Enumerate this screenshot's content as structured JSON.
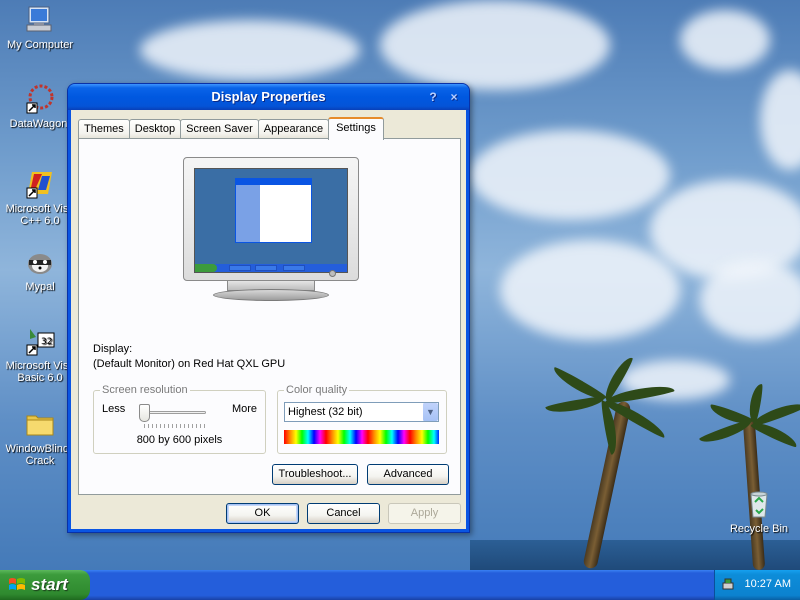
{
  "desktop": {
    "icons": [
      {
        "label": "My Computer",
        "icon": "my-computer-icon"
      },
      {
        "label": "DataWagon.",
        "icon": "shortcut-icon"
      },
      {
        "label_line1": "Microsoft Visu",
        "label_line2": "C++ 6.0",
        "icon": "visual-cpp-icon"
      },
      {
        "label": "Mypal",
        "icon": "mypal-icon"
      },
      {
        "label_line1": "Microsoft Visu",
        "label_line2": "Basic 6.0",
        "icon": "visual-basic-icon"
      },
      {
        "label_line1": "WindowBlinds",
        "label_line2": "Crack",
        "icon": "folder-icon"
      },
      {
        "label": "Recycle Bin",
        "icon": "recycle-bin-icon"
      }
    ]
  },
  "dialog": {
    "title": "Display Properties",
    "help_glyph": "?",
    "close_glyph": "×",
    "tabs": [
      {
        "label": "Themes",
        "active": false
      },
      {
        "label": "Desktop",
        "active": false
      },
      {
        "label": "Screen Saver",
        "active": false
      },
      {
        "label": "Appearance",
        "active": false
      },
      {
        "label": "Settings",
        "active": true
      }
    ],
    "display_label": "Display:",
    "display_value": "(Default Monitor) on Red Hat QXL GPU",
    "resolution": {
      "group_title": "Screen resolution",
      "less": "Less",
      "more": "More",
      "value_text": "800 by 600 pixels",
      "slider_level": 0
    },
    "color_quality": {
      "group_title": "Color quality",
      "selected": "Highest (32 bit)"
    },
    "buttons": {
      "troubleshoot": "Troubleshoot...",
      "advanced": "Advanced",
      "ok": "OK",
      "cancel": "Cancel",
      "apply": "Apply"
    }
  },
  "taskbar": {
    "start_label": "start",
    "clock": "10:27 AM"
  },
  "colors": {
    "titlebar": "#0058e0",
    "taskbar": "#245edb",
    "start": "#3c9b3c",
    "tray": "#0c82cf",
    "dialog_bg": "#ece9d8"
  }
}
